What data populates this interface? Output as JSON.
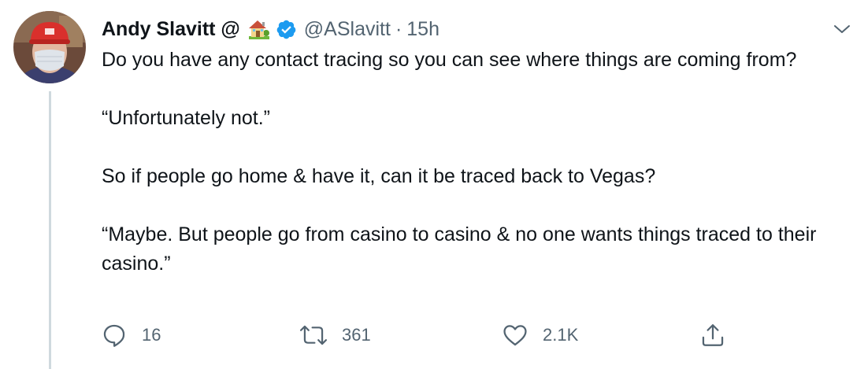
{
  "tweet": {
    "author_name": "Andy Slavitt @",
    "author_emoji_icon": "house-with-garden-icon",
    "verified_icon": "verified-badge-icon",
    "handle": "@ASlavitt",
    "separator": "·",
    "timestamp": "15h",
    "paragraphs": [
      "Do you have any contact tracing so you can see where things are coming from?",
      "“Unfortunately not.”",
      "So if people go home & have it, can it be traced back to Vegas?",
      "“Maybe. But people go from casino to casino & no one wants things traced to their casino.”"
    ],
    "actions": {
      "reply": {
        "icon": "reply-icon",
        "count": "16"
      },
      "retweet": {
        "icon": "retweet-icon",
        "count": "361"
      },
      "like": {
        "icon": "heart-icon",
        "count": "2.1K"
      },
      "share": {
        "icon": "share-icon"
      }
    },
    "menu_icon": "chevron-down-icon"
  },
  "colors": {
    "text": "#0f1419",
    "secondary": "#536471",
    "verified": "#1d9bf0",
    "thread_line": "#cfd9de"
  }
}
